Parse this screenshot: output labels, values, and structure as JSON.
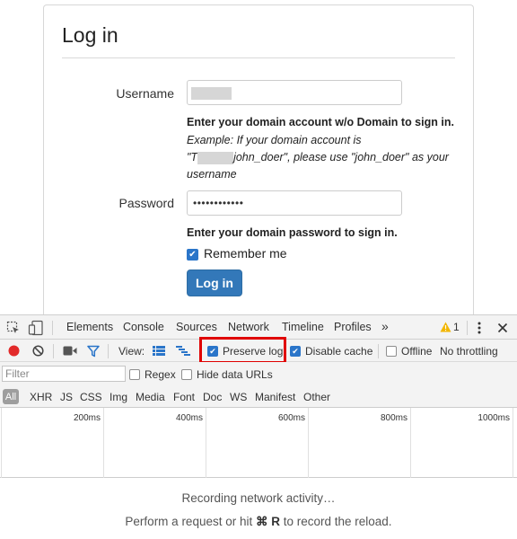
{
  "login": {
    "title": "Log in",
    "username_label": "Username",
    "username_help_strong": "Enter your domain account w/o Domain to sign in.",
    "username_help_example": "Example: If your domain account is",
    "username_help_example_prefix": "\"T",
    "username_help_example_rest": "john_doer\", please use \"john_doer\" as your username",
    "password_label": "Password",
    "password_value": "••••••••••••",
    "password_help": "Enter your domain password to sign in.",
    "remember_label": "Remember me",
    "remember_checked": true,
    "login_button": "Log in"
  },
  "devtools": {
    "tabs": [
      "Elements",
      "Console",
      "Sources",
      "Network",
      "Timeline",
      "Profiles"
    ],
    "more_tabs": "»",
    "warning_count": "1",
    "toolbar": {
      "view_label": "View:",
      "preserve_log": "Preserve log",
      "preserve_log_checked": true,
      "disable_cache": "Disable cache",
      "disable_cache_checked": true,
      "offline": "Offline",
      "offline_checked": false,
      "throttling": "No throttling"
    },
    "filter": {
      "placeholder": "Filter",
      "regex": "Regex",
      "hide_data_urls": "Hide data URLs"
    },
    "types": [
      "All",
      "XHR",
      "JS",
      "CSS",
      "Img",
      "Media",
      "Font",
      "Doc",
      "WS",
      "Manifest",
      "Other"
    ],
    "timeline_labels": [
      "200ms",
      "400ms",
      "600ms",
      "800ms",
      "1000ms"
    ],
    "empty_state": {
      "line1": "Recording network activity…",
      "line2_prefix": "Perform a request or hit ",
      "line2_key": "⌘ R",
      "line2_suffix": " to record the reload."
    },
    "colors": {
      "record_red": "#e22a2a",
      "accent_blue": "#2a75c9",
      "highlight_red": "#e00000"
    }
  }
}
